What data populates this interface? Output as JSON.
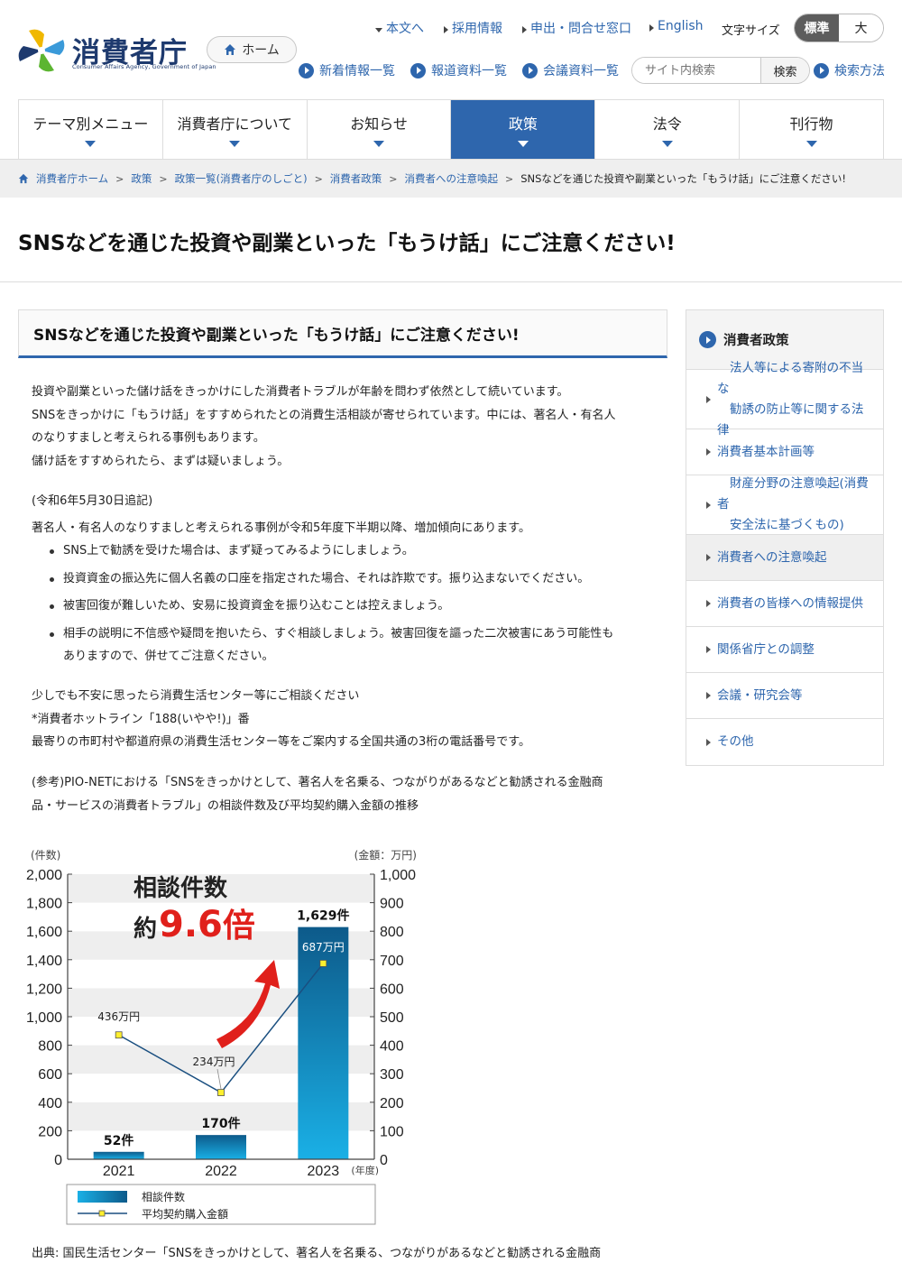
{
  "header": {
    "logo_text": "消費者庁",
    "logo_subtext": "Consumer Affairs Agency, Government of Japan",
    "home_label": "ホーム",
    "top_links": [
      "本文へ",
      "採用情報",
      "申出・問合せ窓口",
      "English"
    ],
    "font_size_label": "文字サイズ",
    "font_size_options": [
      "標準",
      "大"
    ],
    "sub_links": [
      "新着情報一覧",
      "報道資料一覧",
      "会議資料一覧"
    ],
    "search_placeholder": "サイト内検索",
    "search_button": "検索",
    "search_help": "検索方法"
  },
  "nav": [
    "テーマ別メニュー",
    "消費者庁について",
    "お知らせ",
    "政策",
    "法令",
    "刊行物"
  ],
  "breadcrumb": [
    "消費者庁ホーム",
    "政策",
    "政策一覧(消費者庁のしごと)",
    "消費者政策",
    "消費者への注意喚起",
    "SNSなどを通じた投資や副業といった「もうけ話」にご注意ください!"
  ],
  "page_title": "SNSなどを通じた投資や副業といった「もうけ話」にご注意ください!",
  "section_heading": "SNSなどを通じた投資や副業といった「もうけ話」にご注意ください!",
  "intro": [
    "投資や副業といった儲け話をきっかけにした消費者トラブルが年齢を問わず依然として続いています。",
    "SNSをきっかけに「もうけ話」をすすめられたとの消費生活相談が寄せられています。中には、著名人・有名人",
    "のなりすましと考えられる事例もあります。",
    "儲け話をすすめられたら、まずは疑いましょう。"
  ],
  "update_note": "(令和6年5月30日追記)",
  "update_text": "著名人・有名人のなりすましと考えられる事例が令和5年度下半期以降、増加傾向にあります。",
  "bullets": [
    [
      "SNS上で勧誘を受けた場合は、まず疑ってみるようにしましょう。"
    ],
    [
      "投資資金の振込先に個人名義の口座を指定された場合、それは詐欺です。振り込まないでください。"
    ],
    [
      "被害回復が難しいため、安易に投資資金を振り込むことは控えましょう。"
    ],
    [
      "相手の説明に不信感や疑問を抱いたら、すぐ相談しましょう。被害回復を謳った二次被害にあう可能性も",
      "ありますので、併せてご注意ください。"
    ]
  ],
  "consult": [
    "少しでも不安に思ったら消費生活センター等にご相談ください",
    "*消費者ホットライン「188(いやや!)」番",
    "最寄りの市町村や都道府県の消費生活センター等をご案内する全国共通の3桁の電話番号です。"
  ],
  "reference": [
    "(参考)PIO-NETにおける「SNSをきっかけとして、著名人を名乗る、つながりがあるなどと勧誘される金融商",
    "品・サービスの消費者トラブル」の相談件数及び平均契約購入金額の推移"
  ],
  "sidebar": {
    "heading": "消費者政策",
    "items": [
      [
        "法人等による寄附の不当な",
        "勧誘の防止等に関する法律"
      ],
      [
        "消費者基本計画等"
      ],
      [
        "財産分野の注意喚起(消費者",
        "安全法に基づくもの)"
      ],
      [
        "消費者への注意喚起"
      ],
      [
        "消費者の皆様への情報提供"
      ],
      [
        "関係省庁との調整"
      ],
      [
        "会議・研究会等"
      ],
      [
        "その他"
      ]
    ]
  },
  "chart_data": {
    "type": "bar",
    "categories": [
      "2021",
      "2022",
      "2023"
    ],
    "x_unit": "(年度)",
    "series": [
      {
        "name": "相談件数",
        "type": "bar",
        "axis": "left",
        "values": [
          52,
          170,
          1629
        ],
        "labels": [
          "52件",
          "170件",
          "1,629件"
        ],
        "color": "#1a86c4"
      },
      {
        "name": "平均契約購入金額",
        "type": "line",
        "axis": "right",
        "values": [
          436,
          234,
          687
        ],
        "labels": [
          "436万円",
          "234万円",
          "687万円"
        ],
        "color": "#1a4f80"
      }
    ],
    "y_left": {
      "label": "(件数)",
      "lim": [
        0,
        2000
      ],
      "ticks": [
        "0",
        "200",
        "400",
        "600",
        "800",
        "1,000",
        "1,200",
        "1,400",
        "1,600",
        "1,800",
        "2,000"
      ]
    },
    "y_right": {
      "label": "(金額：万円)",
      "lim": [
        0,
        1000
      ],
      "ticks": [
        "0",
        "100",
        "200",
        "300",
        "400",
        "500",
        "600",
        "700",
        "800",
        "900",
        "1,000"
      ]
    },
    "annotation_top": "相談件数",
    "annotation_prefix": "約",
    "annotation_value": "9.6",
    "annotation_suffix": "倍",
    "annotation_color": "#e0201b",
    "legend": [
      "相談件数",
      "平均契約購入金額"
    ]
  },
  "source_text": "出典: 国民生活センター「SNSをきっかけとして、著名人を名乗る、つながりがあるなどと勧誘される金融商"
}
